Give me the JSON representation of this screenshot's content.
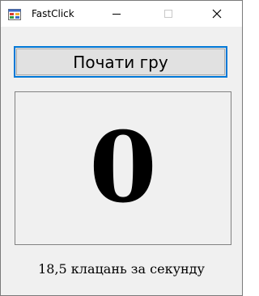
{
  "window": {
    "title": "FastClick",
    "icon": "windows-forms-app-icon",
    "controls": [
      "minimize-icon",
      "maximize-icon",
      "close-icon"
    ]
  },
  "main": {
    "start_button_label": "Почати гру",
    "counter_value": "0",
    "rate_label": "18,5 клацань за секунду"
  },
  "colors": {
    "focus_border": "#0078d7",
    "button_face": "#e1e1e1",
    "client_background": "#f0f0f0"
  }
}
